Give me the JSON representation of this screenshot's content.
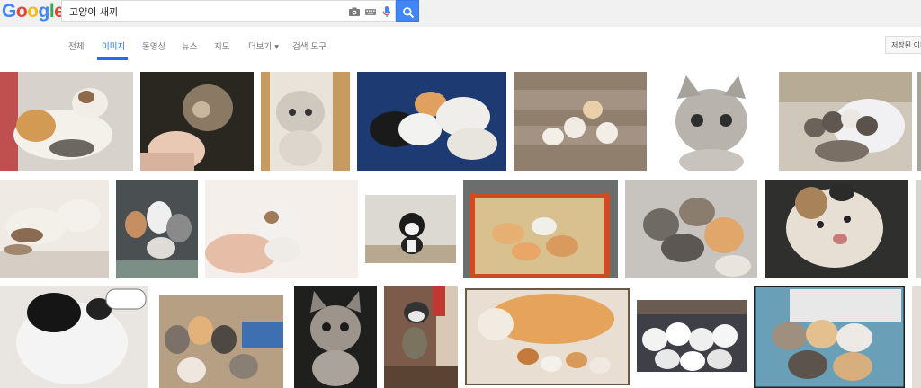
{
  "header": {
    "logo_letters": [
      {
        "char": "G",
        "color": "#4285f4"
      },
      {
        "char": "o",
        "color": "#ea4335"
      },
      {
        "char": "o",
        "color": "#fbbc05"
      },
      {
        "char": "g",
        "color": "#4285f4"
      },
      {
        "char": "l",
        "color": "#34a853"
      },
      {
        "char": "e",
        "color": "#ea4335"
      }
    ],
    "query": "고양이 새끼",
    "icons": [
      "camera-icon",
      "keyboard-icon",
      "microphone-icon",
      "search-icon"
    ]
  },
  "tabs": [
    {
      "label": "전체",
      "active": false
    },
    {
      "label": "이미지",
      "active": true
    },
    {
      "label": "동영상",
      "active": false
    },
    {
      "label": "뉴스",
      "active": false
    },
    {
      "label": "지도",
      "active": false
    },
    {
      "label": "더보기 ▾",
      "active": false
    },
    {
      "label": "검색 도구",
      "active": false
    }
  ],
  "saved_button": "저장된 이미",
  "thumbnails_count": 24,
  "colors": {
    "accent": "#1a73e8",
    "search_blue": "#4285f4",
    "topbar_bg": "#f1f1f1"
  }
}
